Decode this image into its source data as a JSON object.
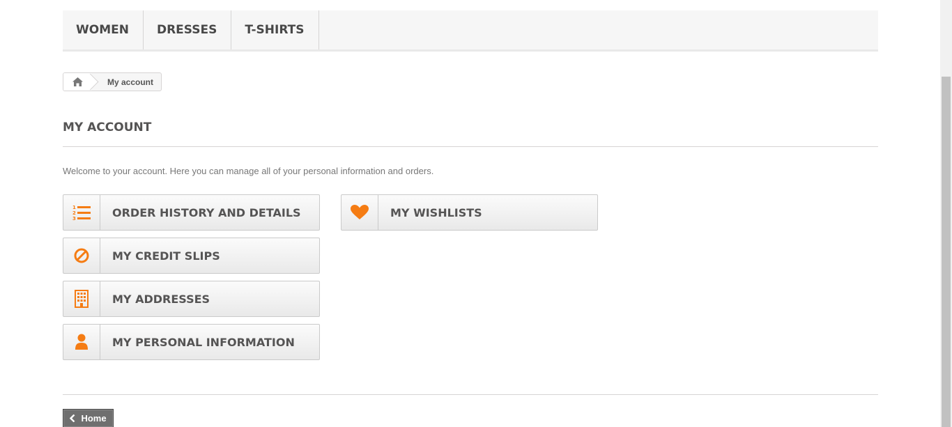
{
  "nav": {
    "items": [
      {
        "label": "WOMEN"
      },
      {
        "label": "DRESSES"
      },
      {
        "label": "T-SHIRTS"
      }
    ]
  },
  "breadcrumb": {
    "home_icon": "home-icon",
    "current": "My account"
  },
  "page": {
    "title": "MY ACCOUNT",
    "welcome": "Welcome to your account. Here you can manage all of your personal information and orders."
  },
  "account_links": [
    {
      "label": "ORDER HISTORY AND DETAILS",
      "icon": "numbered-list-icon"
    },
    {
      "label": "MY CREDIT SLIPS",
      "icon": "ban-icon"
    },
    {
      "label": "MY ADDRESSES",
      "icon": "building-icon"
    },
    {
      "label": "MY PERSONAL INFORMATION",
      "icon": "user-icon"
    },
    {
      "label": "MY WISHLISTS",
      "icon": "heart-icon"
    }
  ],
  "footer": {
    "home_label": "Home",
    "home_icon": "chevron-left-icon"
  },
  "colors": {
    "accent": "#f57c13",
    "nav_bg": "#f6f6f6",
    "text": "#555454"
  }
}
